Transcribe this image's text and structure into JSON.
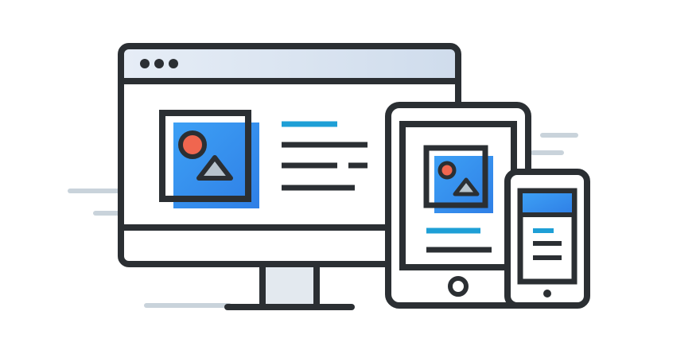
{
  "illustration": {
    "subject": "responsive-devices",
    "devices": [
      "desktop-monitor",
      "tablet",
      "smartphone"
    ]
  },
  "colors": {
    "background": "#ffffff",
    "stroke": "#2b2f33",
    "accent_blue": "#3d9cf0",
    "accent_blue_light": "#5aa8f7",
    "accent_teal": "#1e9fd6",
    "accent_red": "#f0664f",
    "accent_gray": "#b7c3cc",
    "shadow": "#e3e9ef",
    "speed_lines": "#c9d3db"
  }
}
